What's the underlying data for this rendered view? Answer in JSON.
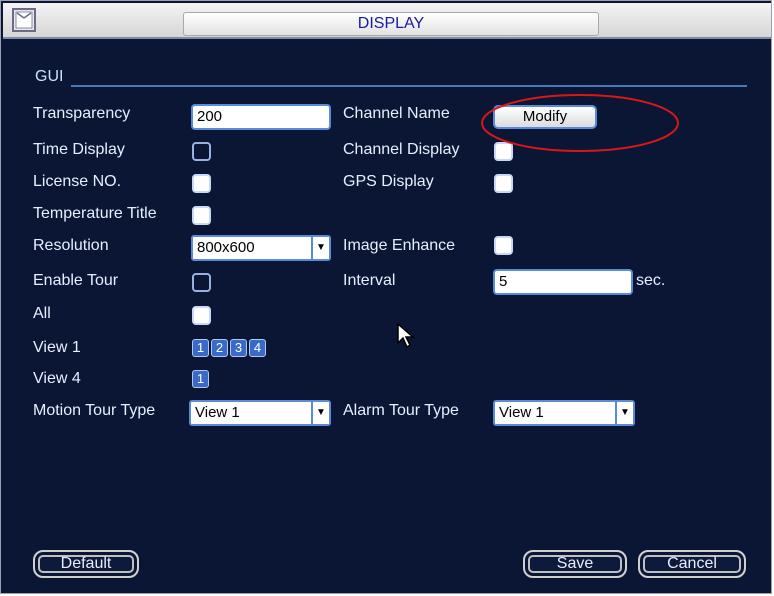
{
  "window": {
    "title": "DISPLAY"
  },
  "section": {
    "label": "GUI"
  },
  "fields": {
    "transparency": {
      "label": "Transparency",
      "value": "200"
    },
    "channel_name": {
      "label": "Channel Name",
      "button": "Modify"
    },
    "time_display": {
      "label": "Time Display",
      "checked": false
    },
    "channel_display": {
      "label": "Channel Display",
      "checked": true
    },
    "license_no": {
      "label": "License NO.",
      "checked": true
    },
    "gps_display": {
      "label": "GPS Display",
      "checked": true
    },
    "temperature_title": {
      "label": "Temperature Title",
      "checked": true
    },
    "resolution": {
      "label": "Resolution",
      "value": "800x600"
    },
    "image_enhance": {
      "label": "Image Enhance",
      "checked": true
    },
    "enable_tour": {
      "label": "Enable Tour",
      "checked": false
    },
    "interval": {
      "label": "Interval",
      "value": "5",
      "unit": "sec."
    },
    "all": {
      "label": "All",
      "checked": true
    },
    "view1": {
      "label": "View 1",
      "channels": [
        "1",
        "2",
        "3",
        "4"
      ]
    },
    "view4": {
      "label": "View 4",
      "channels": [
        "1"
      ]
    },
    "motion_tour_type": {
      "label": "Motion Tour Type",
      "value": "View 1"
    },
    "alarm_tour_type": {
      "label": "Alarm Tour Type",
      "value": "View 1"
    }
  },
  "buttons": {
    "default": "Default",
    "save": "Save",
    "cancel": "Cancel"
  },
  "colors": {
    "panel": "#0a1634",
    "title_text": "#1a1aa0",
    "annotation": "#d81818",
    "accent": "#5a8ad8"
  }
}
